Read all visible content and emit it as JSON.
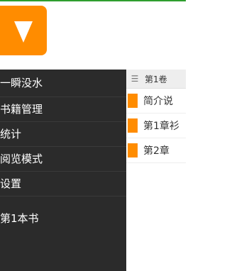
{
  "colors": {
    "accent": "#ff8c00",
    "top_line": "#2e9e2e",
    "drawer_bg": "#2b2b2b",
    "header_bg": "#eeeeee"
  },
  "app_icon": {
    "icon": "triangle-down-icon"
  },
  "drawer": {
    "items": [
      {
        "label": "一瞬没水"
      },
      {
        "label": "书籍管理"
      },
      {
        "label": "统计"
      },
      {
        "label": "阅览模式"
      },
      {
        "label": "设置"
      },
      {
        "label": "第1本书"
      }
    ]
  },
  "content": {
    "menu_icon": "hamburger-menu-icon",
    "header_title": "第1卷",
    "rows": [
      {
        "label": "简介说"
      },
      {
        "label": "第1章衫"
      },
      {
        "label": "第2章"
      }
    ]
  }
}
